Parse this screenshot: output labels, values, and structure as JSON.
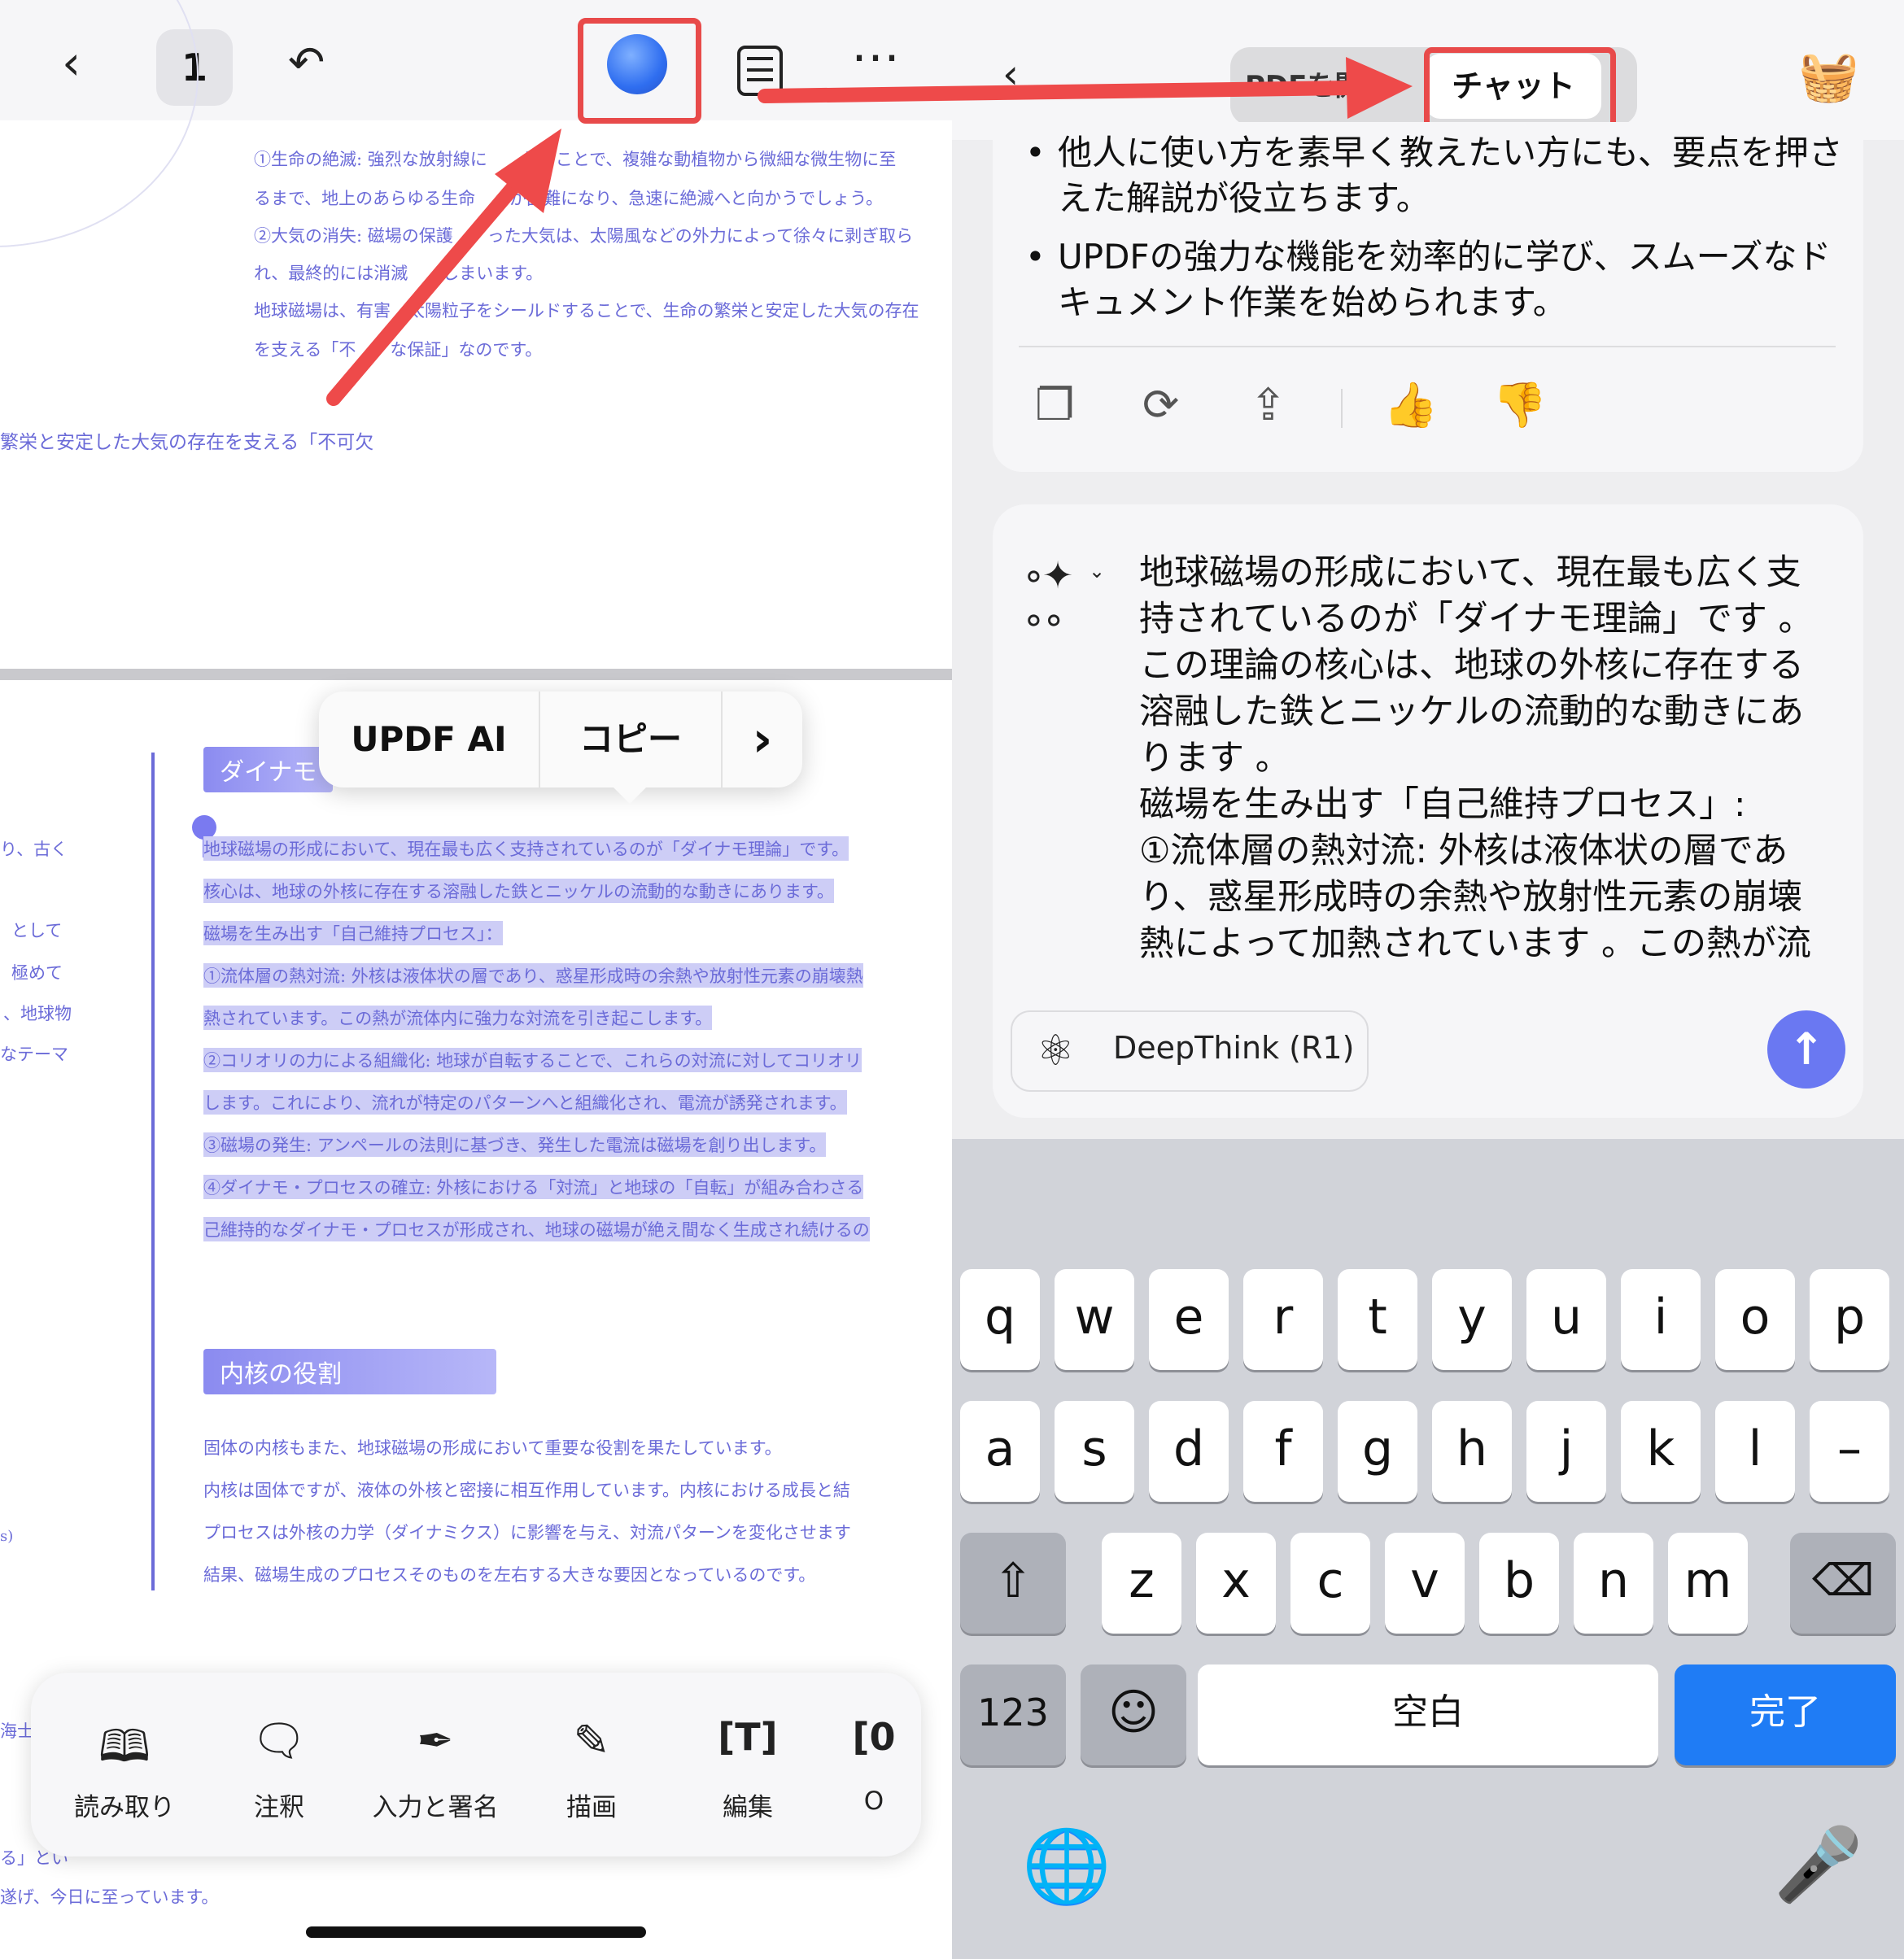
{
  "left": {
    "page_number": "1",
    "doc_top_lines": [
      "①生命の絶滅: 強烈な放射線に　　れることで、複雑な動植物から微細な微生物に至",
      "るまで、地上のあらゆる生命　　が困難になり、急速に絶滅へと向かうでしょう。",
      "②大気の消失: 磁場の保護　　った大気は、太陽風などの外力によって徐々に剥ぎ取ら",
      "れ、最終的には消滅　　しまいます。",
      "地球磁場は、有害　太陽粒子をシールドすることで、生命の繁栄と安定した大気の存在",
      "を支える「不　　な保証」なのです。"
    ],
    "doc_fragment": "繁栄と安定した大気の存在を支える「不可欠",
    "heading1": "ダイナモ",
    "margin_fragments": [
      "り、古く",
      "として",
      "極めて",
      "、地球物",
      "なテーマ",
      "s)",
      "海士",
      "る」とい",
      "遂げ、今日に至っています。"
    ],
    "selected_lines": [
      "地球磁場の形成において、現在最も広く支持されているのが「ダイナモ理論」です。",
      "核心は、地球の外核に存在する溶融した鉄とニッケルの流動的な動きにあります。",
      "磁場を生み出す「自己維持プロセス」：",
      "①流体層の熱対流: 外核は液体状の層であり、惑星形成時の余熱や放射性元素の崩壊熱",
      "熱されています。この熱が流体内に強力な対流を引き起こします。",
      "②コリオリの力による組織化: 地球が自転することで、これらの対流に対してコリオリ",
      "します。これにより、流れが特定のパターンへと組織化され、電流が誘発されます。",
      "③磁場の発生: アンペールの法則に基づき、発生した電流は磁場を創り出します。",
      "④ダイナモ・プロセスの確立: 外核における「対流」と地球の「自転」が組み合わさる",
      "己維持的なダイナモ・プロセスが形成され、地球の磁場が絶え間なく生成され続けるの"
    ],
    "heading2": "内核の役割",
    "body2_lines": [
      "固体の内核もまた、地球磁場の形成において重要な役割を果たしています。",
      "内核は固体ですが、液体の外核と密接に相互作用しています。内核における成長と結",
      "プロセスは外核の力学（ダイナミクス）に影響を与え、対流パターンを変化させます",
      "結果、磁場生成のプロセスそのものを左右する大きな要因となっているのです。"
    ],
    "popup": {
      "ai": "UPDF AI",
      "copy": "コピー",
      "more": "›"
    },
    "toolbar": [
      {
        "label": "読み取り",
        "icon": "book-icon"
      },
      {
        "label": "注釈",
        "icon": "comment-icon"
      },
      {
        "label": "入力と署名",
        "icon": "signature-icon"
      },
      {
        "label": "描画",
        "icon": "pen-icon"
      },
      {
        "label": "編集",
        "icon": "text-edit-icon"
      },
      {
        "label": "O",
        "icon": "ocr-icon"
      }
    ]
  },
  "right": {
    "segment_left": "PDFを開く",
    "segment_chat": "チャット",
    "bullets": [
      "他人に使い方を素早く教えたい方にも、要点を押さえた解説が役立ちます。",
      "UPDFの強力な機能を効率的に学び、スムーズなドキュメント作業を始められます。"
    ],
    "message_lines": [
      "地球磁場の形成において、現在最も広く支",
      "持されているのが「ダイナモ理論」です 。",
      "この理論の核心は、地球の外核に存在する",
      "溶融した鉄とニッケルの流動的な動きにあ",
      "ります 。",
      "磁場を生み出す「自己維持プロセス」:",
      "①流体層の熱対流: 外核は液体状の層であ",
      "り、惑星形成時の余熱や放射性元素の崩壊",
      "熱によって加熱されています 。この熱が流"
    ],
    "deepthink_label": "DeepThink (R1)",
    "keyboard": {
      "row1": [
        "q",
        "w",
        "e",
        "r",
        "t",
        "y",
        "u",
        "i",
        "o",
        "p"
      ],
      "row2": [
        "a",
        "s",
        "d",
        "f",
        "g",
        "h",
        "j",
        "k",
        "l",
        "–"
      ],
      "row3": [
        "z",
        "x",
        "c",
        "v",
        "b",
        "n",
        "m"
      ],
      "numbers": "123",
      "space": "空白",
      "done": "完了"
    }
  },
  "colors": {
    "highlight": "#e84a4a",
    "accent": "#6a78f2",
    "selection": "#cdcdf6",
    "done_key": "#1f7cf5"
  }
}
